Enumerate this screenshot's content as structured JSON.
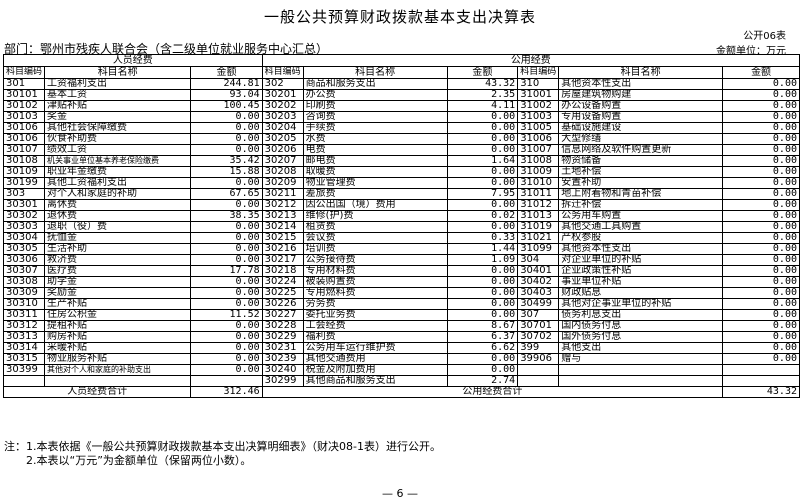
{
  "title": "一般公共预算财政拨款基本支出决算表",
  "form_code": "公开06表",
  "department": "部门：鄂州市残疾人联合会（含二级单位就业服务中心汇总）",
  "unit": "金额单位：万元",
  "headers": {
    "personnel": "人员经费",
    "public": "公用经费",
    "code": "科目编码",
    "name": "科目名称",
    "amount": "金额"
  },
  "personnel_rows": [
    {
      "code": "301",
      "name": "工资福利支出",
      "amount": "244.81"
    },
    {
      "code": "30101",
      "name": "基本工资",
      "amount": "93.04"
    },
    {
      "code": "30102",
      "name": "津贴补贴",
      "amount": "100.45"
    },
    {
      "code": "30103",
      "name": "奖金",
      "amount": "0.00"
    },
    {
      "code": "30106",
      "name": "其他社会保障缴费",
      "amount": "0.00"
    },
    {
      "code": "30106",
      "name": "伙食补助费",
      "amount": "0.00"
    },
    {
      "code": "30107",
      "name": "绩效工资",
      "amount": "0.00"
    },
    {
      "code": "30108",
      "name": "机关事业单位基本养老保险缴费",
      "amount": "35.42"
    },
    {
      "code": "30109",
      "name": "职业年金缴费",
      "amount": "15.88"
    },
    {
      "code": "30199",
      "name": "其他工资福利支出",
      "amount": "0.00"
    },
    {
      "code": "303",
      "name": "对个人和家庭的补助",
      "amount": "67.65"
    },
    {
      "code": "30301",
      "name": "离休费",
      "amount": "0.00"
    },
    {
      "code": "30302",
      "name": "退休费",
      "amount": "38.35"
    },
    {
      "code": "30303",
      "name": "退职（役）费",
      "amount": "0.00"
    },
    {
      "code": "30304",
      "name": "抚恤金",
      "amount": "0.00"
    },
    {
      "code": "30305",
      "name": "生活补助",
      "amount": "0.00"
    },
    {
      "code": "30306",
      "name": "救济费",
      "amount": "0.00"
    },
    {
      "code": "30307",
      "name": "医疗费",
      "amount": "17.78"
    },
    {
      "code": "30308",
      "name": "助学金",
      "amount": "0.00"
    },
    {
      "code": "30309",
      "name": "奖励金",
      "amount": "0.00"
    },
    {
      "code": "30310",
      "name": "生产补贴",
      "amount": "0.00"
    },
    {
      "code": "30311",
      "name": "住房公积金",
      "amount": "11.52"
    },
    {
      "code": "30312",
      "name": "提租补贴",
      "amount": "0.00"
    },
    {
      "code": "30313",
      "name": "购房补贴",
      "amount": "0.00"
    },
    {
      "code": "30314",
      "name": "采暖补贴",
      "amount": "0.00"
    },
    {
      "code": "30315",
      "name": "物业服务补贴",
      "amount": "0.00"
    },
    {
      "code": "30399",
      "name": "其他对个人和家庭的补助支出",
      "amount": "0.00"
    },
    {
      "code": "",
      "name": "",
      "amount": ""
    }
  ],
  "public_rows_a": [
    {
      "code": "302",
      "name": "商品和服务支出",
      "amount": "43.32"
    },
    {
      "code": "30201",
      "name": "办公费",
      "amount": "2.35"
    },
    {
      "code": "30202",
      "name": "印刷费",
      "amount": "4.11"
    },
    {
      "code": "30203",
      "name": "咨询费",
      "amount": "0.00"
    },
    {
      "code": "30204",
      "name": "手续费",
      "amount": "0.00"
    },
    {
      "code": "30205",
      "name": "水费",
      "amount": "0.00"
    },
    {
      "code": "30206",
      "name": "电费",
      "amount": "0.00"
    },
    {
      "code": "30207",
      "name": "邮电费",
      "amount": "1.64"
    },
    {
      "code": "30208",
      "name": "取暖费",
      "amount": "0.00"
    },
    {
      "code": "30209",
      "name": "物业管理费",
      "amount": "0.00"
    },
    {
      "code": "30211",
      "name": "差旅费",
      "amount": "7.95"
    },
    {
      "code": "30212",
      "name": "因公出国（境）费用",
      "amount": "0.00"
    },
    {
      "code": "30213",
      "name": "维修(护)费",
      "amount": "0.02"
    },
    {
      "code": "30214",
      "name": "租赁费",
      "amount": "0.00"
    },
    {
      "code": "30215",
      "name": "会议费",
      "amount": "0.33"
    },
    {
      "code": "30216",
      "name": "培训费",
      "amount": "1.44"
    },
    {
      "code": "30217",
      "name": "公务接待费",
      "amount": "1.09"
    },
    {
      "code": "30218",
      "name": "专用材料费",
      "amount": "0.00"
    },
    {
      "code": "30224",
      "name": "被装购置费",
      "amount": "0.00"
    },
    {
      "code": "30225",
      "name": "专用燃料费",
      "amount": "0.00"
    },
    {
      "code": "30226",
      "name": "劳务费",
      "amount": "0.00"
    },
    {
      "code": "30227",
      "name": "委托业务费",
      "amount": "0.00"
    },
    {
      "code": "30228",
      "name": "工会经费",
      "amount": "8.67"
    },
    {
      "code": "30229",
      "name": "福利费",
      "amount": "6.37"
    },
    {
      "code": "30231",
      "name": "公务用车运行维护费",
      "amount": "6.62"
    },
    {
      "code": "30239",
      "name": "其他交通费用",
      "amount": "0.00"
    },
    {
      "code": "30240",
      "name": "税金及附加费用",
      "amount": "0.00"
    },
    {
      "code": "30299",
      "name": "其他商品和服务支出",
      "amount": "2.74"
    }
  ],
  "public_rows_b": [
    {
      "code": "310",
      "name": "其他资本性支出",
      "amount": "0.00"
    },
    {
      "code": "31001",
      "name": "房屋建筑物购建",
      "amount": "0.00"
    },
    {
      "code": "31002",
      "name": "办公设备购置",
      "amount": "0.00"
    },
    {
      "code": "31003",
      "name": "专用设备购置",
      "amount": "0.00"
    },
    {
      "code": "31005",
      "name": "基础设施建设",
      "amount": "0.00"
    },
    {
      "code": "31006",
      "name": "大型修缮",
      "amount": "0.00"
    },
    {
      "code": "31007",
      "name": "信息网络及软件购置更新",
      "amount": "0.00"
    },
    {
      "code": "31008",
      "name": "物资储备",
      "amount": "0.00"
    },
    {
      "code": "31009",
      "name": "土地补偿",
      "amount": "0.00"
    },
    {
      "code": "31010",
      "name": "安置补助",
      "amount": "0.00"
    },
    {
      "code": "31011",
      "name": "地上附着物和青苗补偿",
      "amount": "0.00"
    },
    {
      "code": "31012",
      "name": "拆迁补偿",
      "amount": "0.00"
    },
    {
      "code": "31013",
      "name": "公务用车购置",
      "amount": "0.00"
    },
    {
      "code": "31019",
      "name": "其他交通工具购置",
      "amount": "0.00"
    },
    {
      "code": "31021",
      "name": "产权参股",
      "amount": "0.00"
    },
    {
      "code": "31099",
      "name": "其他资本性支出",
      "amount": "0.00"
    },
    {
      "code": "304",
      "name": "对企业单位的补贴",
      "amount": "0.00"
    },
    {
      "code": "30401",
      "name": "企业政策性补贴",
      "amount": "0.00"
    },
    {
      "code": "30402",
      "name": "事业单位补贴",
      "amount": "0.00"
    },
    {
      "code": "30403",
      "name": "财政贴息",
      "amount": "0.00"
    },
    {
      "code": "30499",
      "name": "其他对企事业单位的补贴",
      "amount": "0.00"
    },
    {
      "code": "307",
      "name": "债务利息支出",
      "amount": "0.00"
    },
    {
      "code": "30701",
      "name": "国内债务付息",
      "amount": "0.00"
    },
    {
      "code": "30702",
      "name": "国外债务付息",
      "amount": "0.00"
    },
    {
      "code": "399",
      "name": "其他支出",
      "amount": "0.00"
    },
    {
      "code": "39906",
      "name": "赠与",
      "amount": "0.00"
    },
    {
      "code": "",
      "name": "",
      "amount": ""
    },
    {
      "code": "",
      "name": "",
      "amount": ""
    }
  ],
  "totals": {
    "personnel_label": "人员经费合计",
    "personnel_amount": "312.46",
    "public_label": "公用经费合计",
    "public_amount": "43.32"
  },
  "notes": [
    "注：1.本表依据《一般公共预算财政拨款基本支出决算明细表》（财决08-1表）进行公开。",
    "　　2.本表以“万元”为金额单位（保留两位小数）。"
  ],
  "page_number": "— 6 —"
}
